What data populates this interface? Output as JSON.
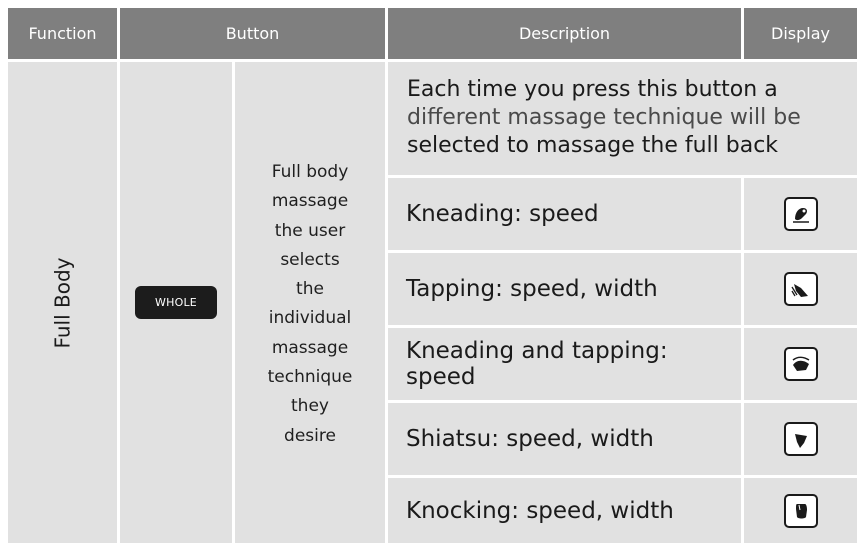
{
  "headers": {
    "function": "Function",
    "button": "Button",
    "description": "Description",
    "display": "Display"
  },
  "row": {
    "function": "Full Body",
    "button_label": "WHOLE",
    "button_description": [
      "Full body",
      "massage",
      "the user",
      "selects",
      "the",
      "individual",
      "massage",
      "technique",
      "they",
      "desire"
    ],
    "intro": [
      "Each time you press this button a",
      "different massage technique will be",
      "selected to massage the full back"
    ],
    "techniques": [
      {
        "label": "Kneading: speed",
        "icon": "kneading-icon"
      },
      {
        "label": "Tapping: speed, width",
        "icon": "tapping-icon"
      },
      {
        "label": "Kneading and tapping: speed",
        "icon": "kneading-tapping-icon"
      },
      {
        "label": "Shiatsu: speed, width",
        "icon": "shiatsu-icon"
      },
      {
        "label": "Knocking: speed, width",
        "icon": "knocking-icon"
      }
    ]
  },
  "colors": {
    "header_bg": "#7f7f7f",
    "cell_bg": "#e1e1e1",
    "button_bg": "#1c1c1c"
  }
}
